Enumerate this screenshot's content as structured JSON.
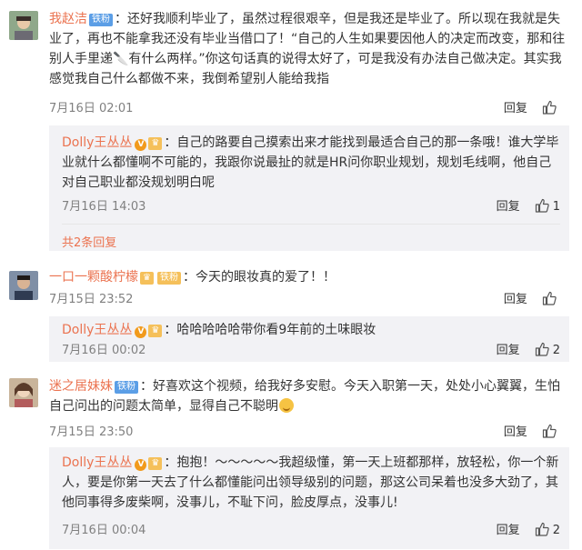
{
  "comments": [
    {
      "username": "我赵洁",
      "badge": "铁粉",
      "text": "：还好我顺利毕业了，虽然过程很艰辛，但是我还是毕业了。所以现在我就是失业了，再也不能拿我还没有毕业当借口了！“自己的人生如果要因他人的决定而改变，那和往别人手里递🔪有什么两样。”你这句话真的说得太好了，可是我没有办法自己做决定。其实我感觉我自己什么都做不来，我倒希望别人能给我指",
      "time": "7月16日 02:01",
      "reply_label": "回复",
      "like_count": "",
      "reply": {
        "username": "Dolly王丛丛",
        "text": "：自己的路要自己摸索出来才能找到最适合自己的那一条哦！谁大学毕业就什么都懂啊不可能的，我跟你说最扯的就是HR问你职业规划，规划毛线啊，他自己对自己职业都没规划明白呢",
        "time": "7月16日 14:03",
        "reply_label": "回复",
        "like_count": "1"
      },
      "more_replies": "共2条回复"
    },
    {
      "username": "一口一颗酸柠檬",
      "badge": "铁粉",
      "text": "：今天的眼妆真的爱了！！",
      "time": "7月15日 23:52",
      "reply_label": "回复",
      "like_count": "",
      "reply": {
        "username": "Dolly王丛丛",
        "text": "：哈哈哈哈哈带你看9年前的土味眼妆",
        "time": "7月16日 00:02",
        "reply_label": "回复",
        "like_count": "2"
      }
    },
    {
      "username": "迷之居妹妹",
      "badge": "铁粉",
      "text": "：好喜欢这个视频，给我好多安慰。今天入职第一天，处处小心翼翼，生怕自己问出的问题太简单，显得自己不聪明",
      "time": "7月15日 23:50",
      "reply_label": "回复",
      "like_count": "",
      "reply": {
        "username": "Dolly王丛丛",
        "text": "：抱抱！～～～～～我超级懂，第一天上班都那样，放轻松，你一个新人，要是你第一天去了什么都懂能问出领导级别的问题，那这公司呆着也没多大劲了，其他同事得多废柴啊，没事儿，不耻下问，脸皮厚点，没事儿!",
        "time": "7月16日 00:04",
        "reply_label": "回复",
        "like_count": "2"
      }
    }
  ],
  "colors": {
    "username": "#eb7350",
    "reply_bg": "#f2f2f5",
    "badge_fan": "#5b9ee6",
    "badge_gold": "#f5c05a",
    "meta": "#808080"
  },
  "icons": {
    "like": "thumbs-up-icon",
    "verified": "v-verified-icon",
    "vip": "crown-icon",
    "emoji": "sweat-smile-emoji-icon"
  }
}
